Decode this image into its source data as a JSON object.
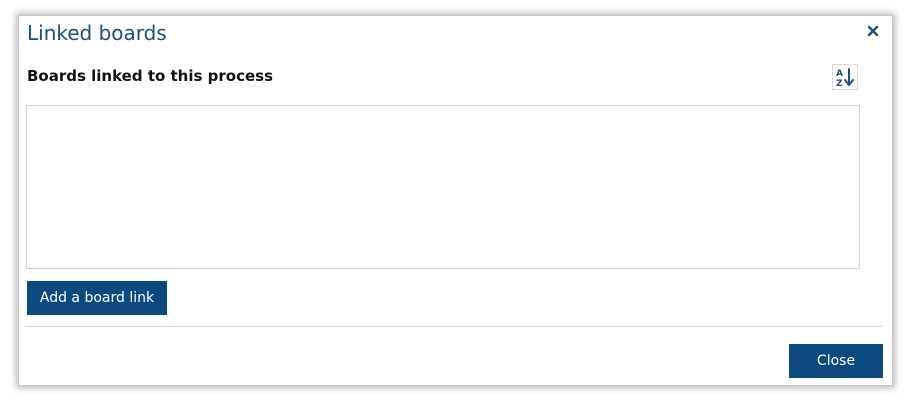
{
  "dialog": {
    "title": "Linked boards",
    "close_icon": "close-icon",
    "section_heading": "Boards linked to this process",
    "sort_icon": "sort-az-icon",
    "boards": [],
    "add_button_label": "Add a board link",
    "close_button_label": "Close"
  },
  "colors": {
    "title": "#1d4f7c",
    "primary_button": "#0b4a7e",
    "border": "#d3d3d3"
  }
}
